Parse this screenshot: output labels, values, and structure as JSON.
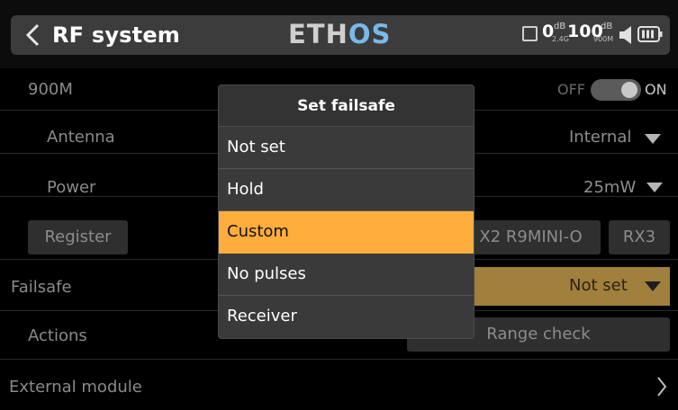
{
  "header": {
    "title": "RF system",
    "brand_prefix": "ETH",
    "brand_accent": "OS",
    "brand_color": "#78b9e8",
    "telemetry": {
      "rssi_1": {
        "value": "0",
        "unit": "dB",
        "band": "2.4G"
      },
      "rssi_2": {
        "value": "100",
        "unit": "dB",
        "band": "900M"
      }
    },
    "icons": [
      "chevron-left-icon",
      "signal-box-icon",
      "speaker-icon",
      "battery-icon"
    ]
  },
  "rows": {
    "band": {
      "label": "900M",
      "toggle_off": "OFF",
      "toggle_on": "ON",
      "enabled": true
    },
    "antenna": {
      "label": "Antenna",
      "value": "Internal"
    },
    "power": {
      "label": "Power",
      "value": "25mW"
    },
    "register": {
      "button": "Register",
      "receiver": "X2 R9MINI-O",
      "slot": "RX3"
    },
    "failsafe": {
      "label": "Failsafe",
      "value": "Not set"
    },
    "actions": {
      "label": "Actions",
      "button": "Range check"
    },
    "external": {
      "label": "External module"
    }
  },
  "modal": {
    "title": "Set failsafe",
    "options": [
      "Not set",
      "Hold",
      "Custom",
      "No pulses",
      "Receiver"
    ],
    "selected": "Custom",
    "highlight_color": "#ffad3c"
  }
}
